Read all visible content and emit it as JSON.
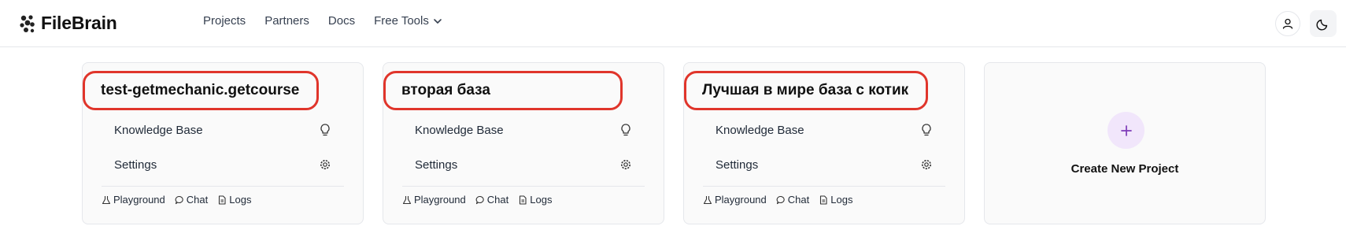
{
  "header": {
    "brand": "FileBrain",
    "nav": [
      "Projects",
      "Partners",
      "Docs",
      "Free Tools"
    ],
    "icons": {
      "logo": "cluster-logo-icon",
      "dropdown": "chevron-down-icon",
      "user": "user-icon",
      "theme": "moon-icon"
    }
  },
  "projects": [
    {
      "title": "test-getmechanic.getcourse",
      "knowledge_base": "Knowledge Base",
      "settings": "Settings",
      "links": [
        "Playground",
        "Chat",
        "Logs"
      ]
    },
    {
      "title": "вторая база",
      "knowledge_base": "Knowledge Base",
      "settings": "Settings",
      "links": [
        "Playground",
        "Chat",
        "Logs"
      ]
    },
    {
      "title": "Лучшая в мире база с котик",
      "knowledge_base": "Knowledge Base",
      "settings": "Settings",
      "links": [
        "Playground",
        "Chat",
        "Logs"
      ]
    }
  ],
  "create_card": {
    "label": "Create New Project",
    "icon": "plus-icon"
  },
  "colors": {
    "highlight": "#e0352b",
    "accent": "#7e3bb8"
  }
}
